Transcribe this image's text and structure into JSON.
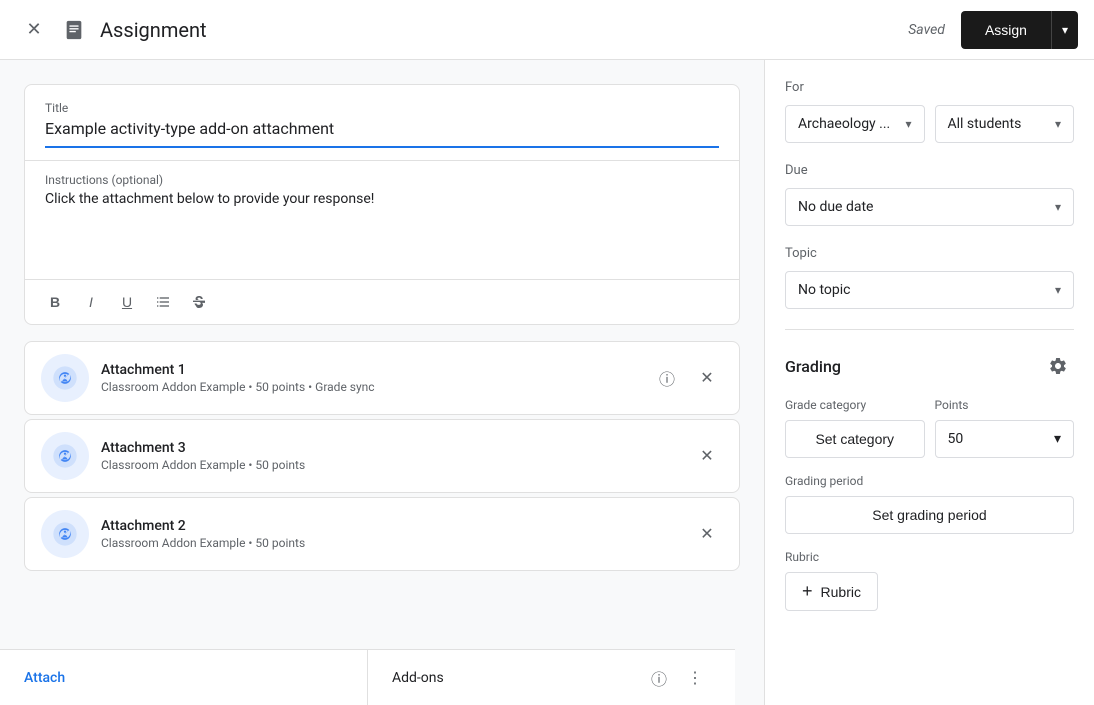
{
  "header": {
    "title": "Assignment",
    "saved_text": "Saved",
    "assign_label": "Assign",
    "dropdown_arrow": "▾"
  },
  "title_field": {
    "label": "Title",
    "value": "Example activity-type add-on attachment"
  },
  "instructions_field": {
    "label": "Instructions (optional)",
    "value": "Click the attachment below to provide your response!"
  },
  "formatting": {
    "bold": "B",
    "italic": "I",
    "underline": "U"
  },
  "attachments": [
    {
      "name": "Attachment 1",
      "meta": "Classroom Addon Example • 50 points • Grade sync"
    },
    {
      "name": "Attachment 3",
      "meta": "Classroom Addon Example • 50 points"
    },
    {
      "name": "Attachment 2",
      "meta": "Classroom Addon Example • 50 points"
    }
  ],
  "bottom_bar": {
    "attach_label": "Attach",
    "addons_label": "Add-ons"
  },
  "right_panel": {
    "for_label": "For",
    "class_value": "Archaeology ...",
    "students_value": "All students",
    "due_label": "Due",
    "due_value": "No due date",
    "topic_label": "Topic",
    "topic_value": "No topic",
    "grading_title": "Grading",
    "grade_category_label": "Grade category",
    "points_label": "Points",
    "set_category_label": "Set category",
    "points_value": "50",
    "grading_period_label": "Grading period",
    "set_grading_period_label": "Set grading period",
    "rubric_label": "Rubric",
    "add_rubric_label": "Rubric"
  }
}
